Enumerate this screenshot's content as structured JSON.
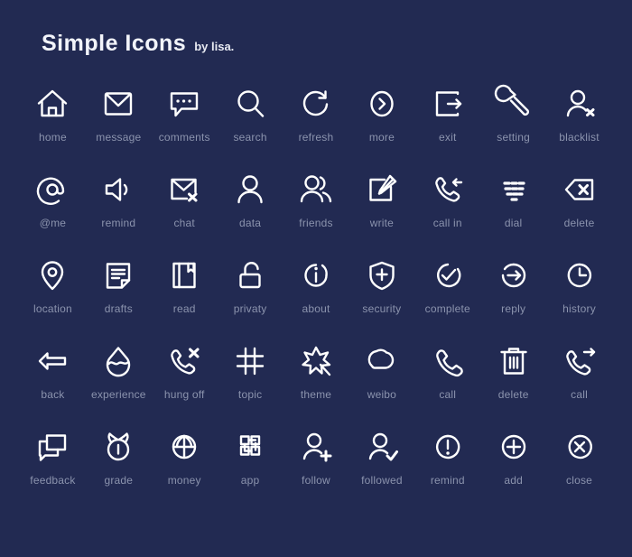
{
  "header": {
    "title": "Simple Icons",
    "byline": "by lisa."
  },
  "colors": {
    "background": "#222a52",
    "icon_stroke": "#ffffff",
    "label": "#8b93ad",
    "title": "#f2f4fa"
  },
  "grid": {
    "columns": 9,
    "rows": 5,
    "count": 45
  },
  "icons": [
    {
      "label": "home",
      "icon": "home-icon"
    },
    {
      "label": "message",
      "icon": "envelope-icon"
    },
    {
      "label": "comments",
      "icon": "speech-bubble-dots-icon"
    },
    {
      "label": "search",
      "icon": "magnifier-icon"
    },
    {
      "label": "refresh",
      "icon": "refresh-arrow-icon"
    },
    {
      "label": "more",
      "icon": "chevron-right-circle-icon"
    },
    {
      "label": "exit",
      "icon": "exit-arrow-icon"
    },
    {
      "label": "setting",
      "icon": "wrench-icon"
    },
    {
      "label": "blacklist",
      "icon": "user-x-icon"
    },
    {
      "label": "@me",
      "icon": "at-sign-icon"
    },
    {
      "label": "remind",
      "icon": "megaphone-icon"
    },
    {
      "label": "chat",
      "icon": "envelope-x-icon"
    },
    {
      "label": "data",
      "icon": "user-icon"
    },
    {
      "label": "friends",
      "icon": "users-icon"
    },
    {
      "label": "write",
      "icon": "pencil-square-icon"
    },
    {
      "label": "call in",
      "icon": "phone-incoming-icon"
    },
    {
      "label": "dial",
      "icon": "keypad-icon"
    },
    {
      "label": "delete",
      "icon": "backspace-x-icon"
    },
    {
      "label": "location",
      "icon": "map-pin-icon"
    },
    {
      "label": "drafts",
      "icon": "document-lines-icon"
    },
    {
      "label": "read",
      "icon": "book-icon"
    },
    {
      "label": "privaty",
      "icon": "unlock-icon"
    },
    {
      "label": "about",
      "icon": "info-circle-icon"
    },
    {
      "label": "security",
      "icon": "shield-plus-icon"
    },
    {
      "label": "complete",
      "icon": "check-circle-icon"
    },
    {
      "label": "reply",
      "icon": "arrow-right-circle-icon"
    },
    {
      "label": "history",
      "icon": "clock-icon"
    },
    {
      "label": "back",
      "icon": "arrow-left-icon"
    },
    {
      "label": "experience",
      "icon": "water-drop-wave-icon"
    },
    {
      "label": "hung off",
      "icon": "phone-x-icon"
    },
    {
      "label": "topic",
      "icon": "hash-icon"
    },
    {
      "label": "theme",
      "icon": "magic-star-wand-icon"
    },
    {
      "label": "weibo",
      "icon": "weibo-eye-icon"
    },
    {
      "label": "call",
      "icon": "phone-icon"
    },
    {
      "label": "delete",
      "icon": "trash-can-icon"
    },
    {
      "label": "call",
      "icon": "phone-forward-icon"
    },
    {
      "label": "feedback",
      "icon": "chat-windows-icon"
    },
    {
      "label": "grade",
      "icon": "alarm-clock-icon"
    },
    {
      "label": "money",
      "icon": "coin-globe-icon"
    },
    {
      "label": "app",
      "icon": "pinwheel-squares-icon"
    },
    {
      "label": "follow",
      "icon": "user-plus-icon"
    },
    {
      "label": "followed",
      "icon": "user-check-icon"
    },
    {
      "label": "remind",
      "icon": "exclamation-circle-icon"
    },
    {
      "label": "add",
      "icon": "plus-circle-icon"
    },
    {
      "label": "close",
      "icon": "x-circle-icon"
    }
  ]
}
